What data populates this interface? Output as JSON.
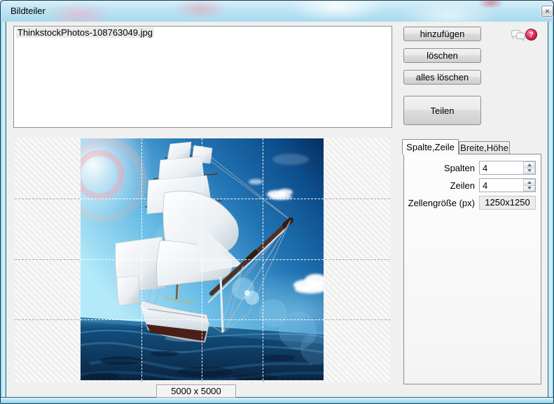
{
  "window": {
    "title": "Bildteiler"
  },
  "icons": {
    "close_glyph": "✕",
    "help_glyph": "?"
  },
  "file_list": {
    "items": [
      "ThinkstockPhotos-108763049.jpg"
    ],
    "selected_index": 0
  },
  "actions": {
    "add": "hinzufügen",
    "remove": "löschen",
    "remove_all": "alles löschen",
    "split": "Teilen"
  },
  "tabs": [
    {
      "label": "Spalte,Zeile",
      "active": true
    },
    {
      "label": "Breite,Höhe",
      "active": false
    }
  ],
  "settings": {
    "columns": {
      "label": "Spalten",
      "value": "4"
    },
    "rows": {
      "label": "Zeilen",
      "value": "4"
    },
    "cell_size": {
      "label": "Zellengröße (px)",
      "value": "1250x1250"
    }
  },
  "preview": {
    "image_size_label": "5000 x 5000",
    "grid_columns": 4,
    "grid_rows": 4
  },
  "colors": {
    "titlebar_glass": "#bde4f4",
    "client_background": "#f0f0f0",
    "help_icon": "#df2459",
    "selection_background": "#ebebeb"
  }
}
